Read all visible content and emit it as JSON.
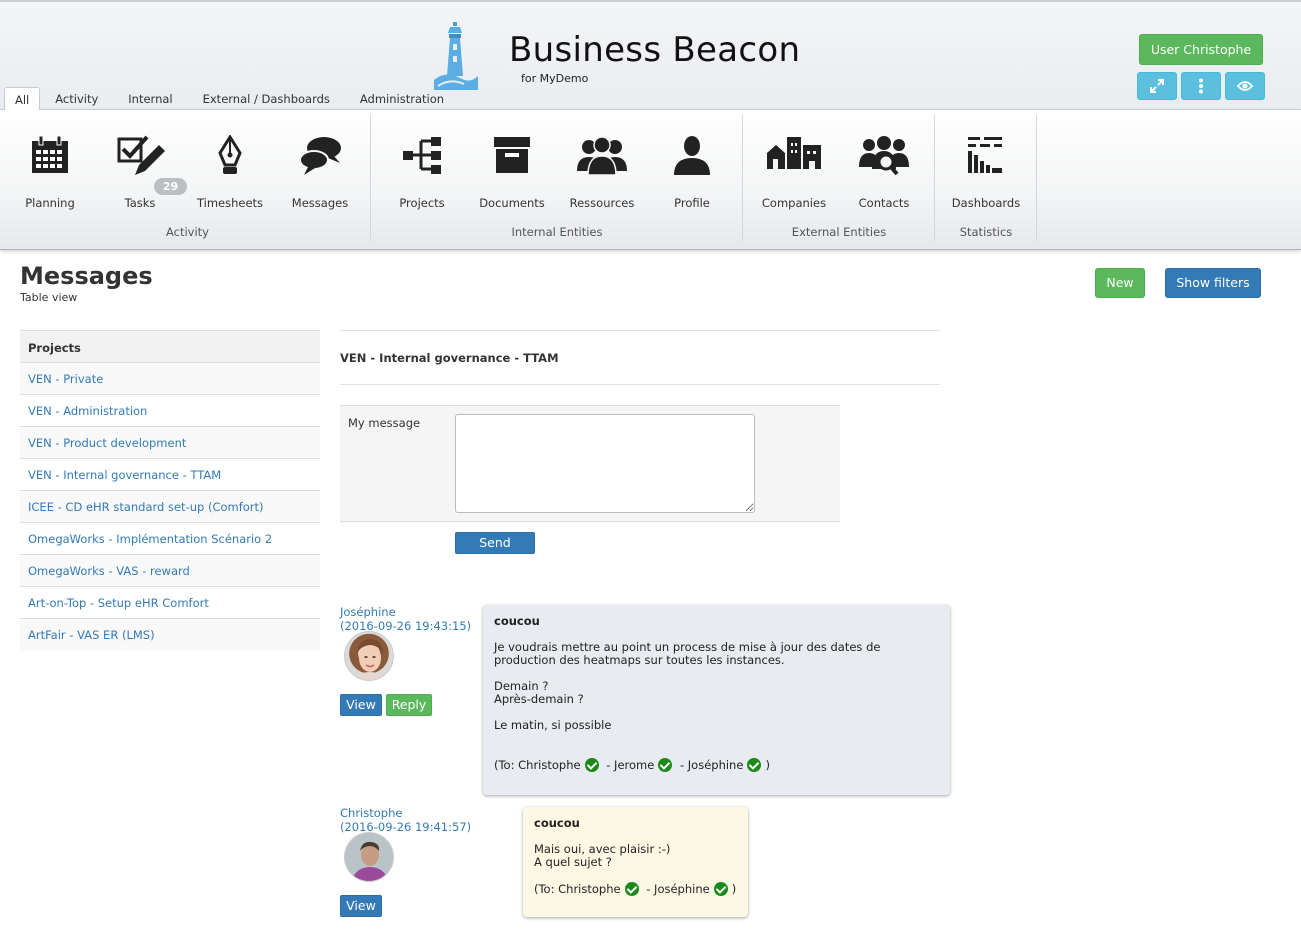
{
  "header": {
    "title": "Business Beacon",
    "subtitle": "for MyDemo",
    "user_button": "User Christophe",
    "tabs": [
      "All",
      "Activity",
      "Internal",
      "External / Dashboards",
      "Administration"
    ],
    "action_icons": [
      "expand-icon",
      "more-vertical-icon",
      "eye-icon"
    ]
  },
  "ribbon": {
    "groups": [
      {
        "label": "Activity",
        "items": [
          {
            "label": "Planning",
            "icon": "calendar-icon"
          },
          {
            "label": "Tasks",
            "icon": "tasks-icon",
            "badge": "29"
          },
          {
            "label": "Timesheets",
            "icon": "pen-nib-icon"
          },
          {
            "label": "Messages",
            "icon": "chat-icon"
          }
        ]
      },
      {
        "label": "Internal Entities",
        "items": [
          {
            "label": "Projects",
            "icon": "sitemap-icon"
          },
          {
            "label": "Documents",
            "icon": "archive-icon"
          },
          {
            "label": "Ressources",
            "icon": "users-icon"
          },
          {
            "label": "Profile",
            "icon": "user-icon"
          }
        ]
      },
      {
        "label": "External Entities",
        "items": [
          {
            "label": "Companies",
            "icon": "buildings-icon"
          },
          {
            "label": "Contacts",
            "icon": "contacts-search-icon"
          }
        ]
      },
      {
        "label": "Statistics",
        "items": [
          {
            "label": "Dashboards",
            "icon": "dashboard-bars-icon"
          }
        ]
      }
    ]
  },
  "page": {
    "title": "Messages",
    "subtitle": "Table view",
    "new_button": "New",
    "filters_button": "Show filters"
  },
  "projects": {
    "header": "Projects",
    "items": [
      "VEN - Private",
      "VEN - Administration",
      "VEN - Product development",
      "VEN - Internal governance - TTAM",
      "ICEE - CD eHR standard set-up (Comfort)",
      "OmegaWorks - Implémentation Scénario 2",
      "OmegaWorks - VAS - reward",
      "Art-on-Top - Setup eHR Comfort",
      "ArtFair - VAS ER (LMS)"
    ]
  },
  "conversation": {
    "title": "VEN - Internal governance - TTAM",
    "form_label": "My message",
    "send_button": "Send"
  },
  "messages": [
    {
      "author": "Joséphine",
      "date": "(2016-09-26 19:43:15)",
      "view_label": "View",
      "reply_label": "Reply",
      "subject": "coucou",
      "lines": [
        "Je voudrais mettre au point un process de mise à jour des dates de",
        "production des heatmaps sur toutes les instances.",
        "",
        "Demain ?",
        "Après-demain ?",
        "",
        "Le matin, si possible",
        "",
        ""
      ],
      "to_prefix": "(To: ",
      "recipients": [
        "Christophe",
        "Jerome",
        "Joséphine"
      ],
      "sep": " - ",
      "to_suffix": ")",
      "bg": "#e8ebef"
    },
    {
      "author": "Christophe",
      "date": "(2016-09-26 19:41:57)",
      "view_label": "View",
      "subject": "coucou",
      "lines": [
        "Mais oui, avec plaisir :-)",
        "A quel sujet ?",
        ""
      ],
      "to_prefix": "(To: ",
      "recipients": [
        "Christophe",
        "Joséphine"
      ],
      "sep": " - ",
      "to_suffix": ")",
      "bg": "#fdf8e4"
    }
  ]
}
